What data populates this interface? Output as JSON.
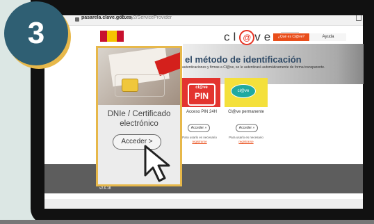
{
  "step": {
    "number": "3"
  },
  "browser": {
    "url_host": "pasarela.clave.gob.es",
    "url_path": "/Proxy2/ServiceProvider"
  },
  "header": {
    "logo_text": "cl",
    "logo_text_2": "ve",
    "btn_que": "¿Qué es Cl@ve?",
    "btn_ayuda": "Ayuda"
  },
  "hero": {
    "title": "el método de identificación",
    "subtitle": "autenticaciones y firmas a Cl@ve, se le autenticará automáticamente de forma transparente."
  },
  "cards": {
    "pin": {
      "badge_top": "cl@ve",
      "badge_main": "PIN",
      "label": "Acceso PIN 24H",
      "button": "Acceder »",
      "note": "Para usarlo es necesario",
      "link": "registrarse"
    },
    "perm": {
      "badge": "cl@ve",
      "label": "Cl@ve permanente",
      "button": "Acceder »",
      "note": "Para usarlo es necesario",
      "link": "registrarse"
    }
  },
  "dni": {
    "title": "DNIe / Certificado electrónico",
    "button": "Acceder  >"
  },
  "footer": {
    "version": "v2.6.18"
  },
  "colors": {
    "accent": "#e7b84a",
    "step_bg": "#2f5f73",
    "clave_red": "#e63323"
  },
  "icons": [
    "lock-icon",
    "share-icon",
    "cursor-icon"
  ]
}
